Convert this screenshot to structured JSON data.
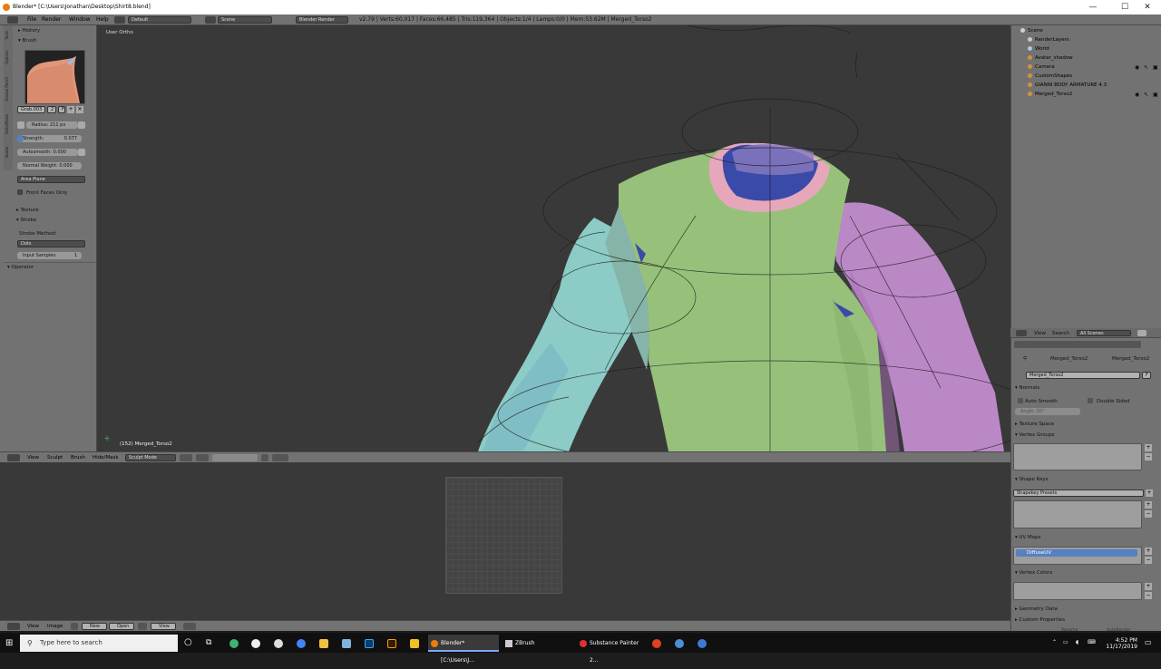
{
  "window": {
    "title": "Blender* [C:\\Users\\Jonathan\\Desktop\\Shirt8.blend]",
    "controls": [
      "—",
      "☐",
      "✕"
    ]
  },
  "menubar": {
    "menus": [
      "File",
      "Render",
      "Window",
      "Help"
    ],
    "layout": "Default",
    "scene": "Scene",
    "engine": "Blender Render",
    "stats": "v2.79 | Verts:60,017 | Faces:66,485 | Tris:119,364 | Objects:1/4 | Lamps:0/0 | Mem:53.62M | Merged_Torso2"
  },
  "left_panel": {
    "tabs": [
      "Tools",
      "Options",
      "Grease Pencil",
      "Slots/Mode",
      "Avatar"
    ],
    "history": "History",
    "brush_section": "Brush",
    "brush_name": "Grab.003",
    "brush_users": "2",
    "brush_f": "F",
    "radius_label": "Radius:",
    "radius_value": "211 px",
    "strength_label": "Strength:",
    "strength_value": "0.077",
    "autosmooth_label": "Autosmooth:",
    "autosmooth_value": "0.000",
    "normal_weight_label": "Normal Weight:",
    "normal_weight_value": "0.000",
    "area_plane": "Area Plane",
    "front_faces": "Front Faces Only",
    "texture": "Texture",
    "stroke": "Stroke",
    "stroke_method_label": "Stroke Method:",
    "stroke_method": "Dots",
    "input_samples_label": "Input Samples:",
    "input_samples_value": "1",
    "operator": "Operator"
  },
  "viewport": {
    "view_label": "User Ortho",
    "object_label": "(152) Merged_Torso2"
  },
  "viewport_header": {
    "menus": [
      "View",
      "Sculpt",
      "Brush",
      "Hide/Mask"
    ],
    "mode": "Sculpt Mode"
  },
  "uv_header": {
    "menus": [
      "View",
      "Image"
    ],
    "new_label": "New",
    "open_label": "Open",
    "view_label": "View"
  },
  "outliner": {
    "items": [
      {
        "label": "Scene",
        "color": "#d0d0d0"
      },
      {
        "label": "RenderLayers",
        "color": "#c8c8c8"
      },
      {
        "label": "World",
        "color": "#a9c7e8"
      },
      {
        "label": "Avatar_shadow",
        "color": "#d58f3a"
      },
      {
        "label": "Camera",
        "color": "#d58f3a"
      },
      {
        "label": "CustomShapes",
        "color": "#d58f3a"
      },
      {
        "label": "GIANNI BODY ARMATURE 4.3",
        "color": "#d58f3a"
      },
      {
        "label": "Merged_Torso2",
        "color": "#d58f3a"
      }
    ]
  },
  "properties": {
    "header_view": "View",
    "header_search": "Search",
    "header_scope": "All Scenes",
    "breadcrumb_1": "Merged_Torso2",
    "breadcrumb_2": "Merged_Torso2",
    "mesh_name": "Merged_Torso2",
    "mesh_f": "F",
    "normals": "Normals",
    "auto_smooth": "Auto Smooth",
    "double_sided": "Double Sided",
    "angle": "Angle:",
    "angle_value": "30°",
    "texture_space": "Texture Space",
    "vertex_groups": "Vertex Groups",
    "shape_keys": "Shape Keys",
    "shapekey_presets": "Shapekey Presets",
    "uv_maps": "UV Maps",
    "uv_map_name": "DiffuseUV",
    "vertex_colors": "Vertex Colors",
    "geometry_data": "Geometry Data",
    "custom_properties": "Custom Properties",
    "bottom_a": "Rename",
    "bottom_b": "AutoRender"
  },
  "taskbar": {
    "search_placeholder": "Type here to search",
    "apps": [
      {
        "label": "Blender* [C:\\Users\\J...",
        "active": true
      },
      {
        "label": "ZBrush",
        "active": false
      },
      {
        "label": "Substance Painter 2...",
        "active": false
      }
    ],
    "time": "4:52 PM",
    "date": "11/17/2019"
  }
}
